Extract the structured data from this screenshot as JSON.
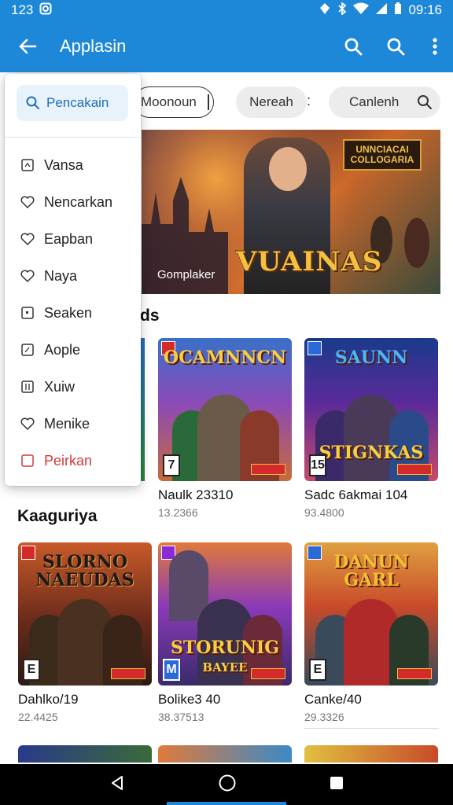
{
  "status_bar": {
    "time_left": "123",
    "time_right": "09:16"
  },
  "app_bar": {
    "title": "Applasin"
  },
  "chips": {
    "outline_text": "Moonoun",
    "grey1_text": "Nereah",
    "separator": ":",
    "grey2_text": "Canlenh"
  },
  "banner": {
    "title": "VUAINAS",
    "logo_text": "UNNCIACAI COLLOGARIA",
    "caption": "Gomplaker"
  },
  "section_partial": "ds",
  "section_heading": "Kaaguriya",
  "cards": [
    {
      "art_title": "OCAMNNCN",
      "name": "Naulk 23310",
      "sub": "13.2366",
      "rating": "7"
    },
    {
      "art_title": "SAUNN",
      "art_title2": "STIGNKAS",
      "name": "Sadc 6akmai 104",
      "sub": "93.4800",
      "rating": "15"
    },
    {
      "art_title": "SLORNO NAEUDAS",
      "name": "Dahlko/19",
      "sub": "22.4425",
      "rating": "E"
    },
    {
      "art_title": "STORUNIG",
      "art_title2": "BAYEE",
      "name": "Bolike3 40",
      "sub": "38.37513",
      "rating": "M"
    },
    {
      "art_title": "DANUN GARL",
      "name": "Canke/40",
      "sub": "29.3326",
      "rating": "E"
    }
  ],
  "dropdown": {
    "search_label": "Pencakain",
    "items": [
      {
        "label": "Vansa",
        "icon": "square-icon"
      },
      {
        "label": "Nencarkan",
        "icon": "heart-icon"
      },
      {
        "label": "Eapban",
        "icon": "heart-icon"
      },
      {
        "label": "Naya",
        "icon": "heart-icon"
      },
      {
        "label": "Seaken",
        "icon": "square-icon"
      },
      {
        "label": "Aople",
        "icon": "square-icon"
      },
      {
        "label": "Xuiw",
        "icon": "square-icon"
      },
      {
        "label": "Menike",
        "icon": "heart-icon"
      },
      {
        "label": "Peirkan",
        "icon": "square-icon",
        "danger": true
      }
    ]
  },
  "colors": {
    "primary": "#1e88d8",
    "danger": "#d33a3a"
  }
}
